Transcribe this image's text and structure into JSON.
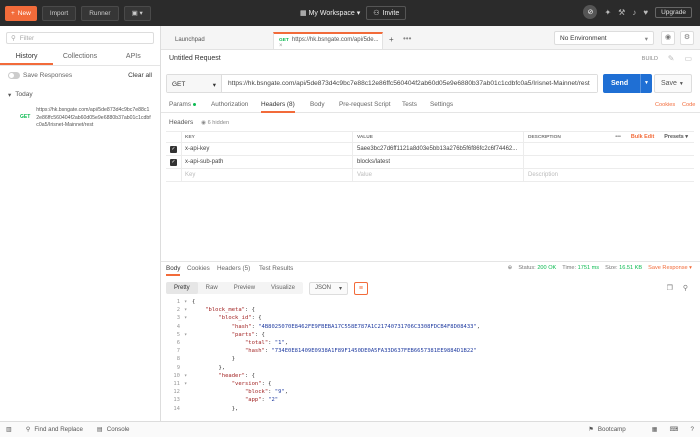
{
  "topbar": {
    "new_label": "New",
    "import_label": "Import",
    "runner_label": "Runner",
    "workspace_label": "My Workspace",
    "invite_label": "Invite",
    "upgrade_label": "Upgrade"
  },
  "sidebar": {
    "filter_placeholder": "Filter",
    "tabs": [
      "History",
      "Collections",
      "APIs"
    ],
    "save_responses_label": "Save Responses",
    "clear_all_label": "Clear all",
    "today_label": "Today",
    "history_item": {
      "method": "GET",
      "url": "https://hk.bsngate.com/api/5de873d4c9bc7e88c12e86ffc560404f2ab60d05e9e6880b37ab01c1cdbfc0a5/Irisnet-Mainnet/rest"
    }
  },
  "tabs": {
    "launchpad_label": "Launchpad",
    "active_method": "GET",
    "active_url": "https://hk.bsngate.com/api/5de...",
    "environment_label": "No Environment"
  },
  "request": {
    "title": "Untitled Request",
    "build_label": "BUILD",
    "method": "GET",
    "url": "https://hk.bsngate.com/api/5de873d4c9bc7e88c12e86ffc560404f2ab60d05e9e6880b37ab01c1cdbfc0a5/Irisnet-Mainnet/rest",
    "send_label": "Send",
    "save_label": "Save",
    "cookies_label": "Cookies",
    "code_label": "Code"
  },
  "subtabs": [
    "Params",
    "Authorization",
    "Headers (8)",
    "Body",
    "Pre-request Script",
    "Tests",
    "Settings"
  ],
  "headers_section": {
    "label": "Headers",
    "hidden_label": "6 hidden",
    "columns": {
      "key": "KEY",
      "value": "VALUE",
      "description": "DESCRIPTION"
    },
    "bulk_edit_label": "Bulk Edit",
    "presets_label": "Presets",
    "rows": [
      {
        "key": "x-api-key",
        "value": "5aee3bc27d6ff1121a8d03e5bb13a276b5f6f86fc2c6f74462..."
      },
      {
        "key": "x-api-sub-path",
        "value": "blocks/latest"
      }
    ],
    "placeholder_key": "Key",
    "placeholder_value": "Value",
    "placeholder_description": "Description"
  },
  "response": {
    "tabs": [
      "Body",
      "Cookies",
      "Headers (5)",
      "Test Results"
    ],
    "status_label": "Status:",
    "status_value": "200 OK",
    "time_label": "Time:",
    "time_value": "1751 ms",
    "size_label": "Size:",
    "size_value": "16.51 KB",
    "save_response_label": "Save Response",
    "views": [
      "Pretty",
      "Raw",
      "Preview",
      "Visualize"
    ],
    "format_label": "JSON"
  },
  "code_lines": [
    {
      "n": "1",
      "a": "▾",
      "t": "{"
    },
    {
      "n": "2",
      "a": "▾",
      "t": "    \"block_meta\": {"
    },
    {
      "n": "3",
      "a": "▾",
      "t": "        \"block_id\": {"
    },
    {
      "n": "4",
      "a": "",
      "t": "            \"hash\": \"4B8025070E8462FE9FBEBA17C558E787A1C21740731706C3308FDCB4F8D08433\","
    },
    {
      "n": "5",
      "a": "▾",
      "t": "            \"parts\": {"
    },
    {
      "n": "6",
      "a": "",
      "t": "                \"total\": \"1\","
    },
    {
      "n": "7",
      "a": "",
      "t": "                \"hash\": \"734E0E81409E0938A1F89F1450DE0A5FA33D637FEB6657381EE9884D1B22\""
    },
    {
      "n": "8",
      "a": "",
      "t": "            }"
    },
    {
      "n": "9",
      "a": "",
      "t": "        },"
    },
    {
      "n": "10",
      "a": "▾",
      "t": "        \"header\": {"
    },
    {
      "n": "11",
      "a": "▾",
      "t": "            \"version\": {"
    },
    {
      "n": "12",
      "a": "",
      "t": "                \"block\": \"9\","
    },
    {
      "n": "13",
      "a": "",
      "t": "                \"app\": \"2\""
    },
    {
      "n": "14",
      "a": "",
      "t": "            },"
    }
  ],
  "footer": {
    "find_replace_label": "Find and Replace",
    "console_label": "Console",
    "bootcamp_label": "Bootcamp"
  }
}
